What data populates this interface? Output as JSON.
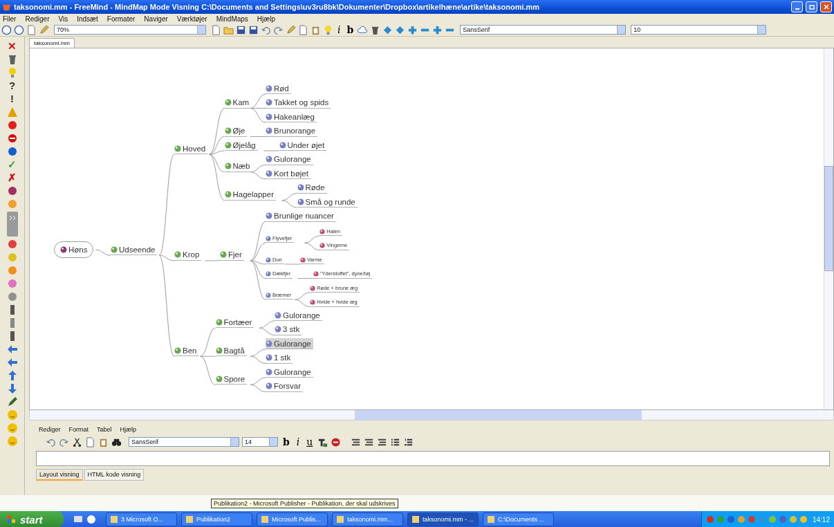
{
  "window": {
    "title": "taksonomi.mm - FreeMind - MindMap Mode Visning C:\\Documents and Settings\\uv3ru8bk\\Dokumenter\\Dropbox\\artikelhæne\\artike\\taksonomi.mm"
  },
  "menu": [
    "Filer",
    "Rediger",
    "Vis",
    "Indsæt",
    "Formater",
    "Naviger",
    "Værktøjer",
    "MindMaps",
    "Hjælp"
  ],
  "toolbar": {
    "zoom": "70%",
    "italic": "i",
    "bold": "b",
    "font": "SansSerif",
    "size": "10"
  },
  "icon_palette": [
    {
      "kind": "glyph",
      "text": "✕",
      "color": "#d01010"
    },
    {
      "kind": "trash",
      "color": "#606060"
    },
    {
      "kind": "bulb",
      "color": "#f0d000"
    },
    {
      "kind": "glyph",
      "text": "?",
      "color": "#303030"
    },
    {
      "kind": "glyph",
      "text": "!",
      "color": "#303030"
    },
    {
      "kind": "warning",
      "color": "#e0a000"
    },
    {
      "kind": "dot",
      "color": "#e02020"
    },
    {
      "kind": "stop",
      "color": "#d01010"
    },
    {
      "kind": "dot",
      "color": "#1060d0"
    },
    {
      "kind": "glyph",
      "text": "✓",
      "color": "#30a030"
    },
    {
      "kind": "glyph",
      "text": "✗",
      "color": "#d01010"
    },
    {
      "kind": "dot",
      "color": "#a03060"
    },
    {
      "kind": "dot",
      "color": "#f0a030"
    },
    {
      "kind": "expander",
      "color": "#9a9a9a"
    },
    {
      "kind": "dot",
      "color": "#e04040"
    },
    {
      "kind": "dot",
      "color": "#e0c020"
    },
    {
      "kind": "dot",
      "color": "#f09020"
    },
    {
      "kind": "dot",
      "color": "#e070c0"
    },
    {
      "kind": "dot",
      "color": "#909090"
    },
    {
      "kind": "bar",
      "color": "#555555"
    },
    {
      "kind": "bar",
      "color": "#888888"
    },
    {
      "kind": "bar",
      "color": "#555555"
    },
    {
      "kind": "arrow-left",
      "color": "#3070d0"
    },
    {
      "kind": "arrow-left",
      "color": "#3070d0"
    },
    {
      "kind": "arrow-up",
      "color": "#3070d0"
    },
    {
      "kind": "arrow-down",
      "color": "#3070d0"
    },
    {
      "kind": "pencil",
      "color": "#3a6a2a"
    },
    {
      "kind": "smiley",
      "color": "#f0c000"
    },
    {
      "kind": "smiley",
      "color": "#f0c000"
    },
    {
      "kind": "smiley",
      "color": "#f0c000"
    }
  ],
  "tabs": [
    {
      "label": "taksonomi.mm",
      "selected": true
    }
  ],
  "map": {
    "root": {
      "label": "Høns",
      "color": "#8a3a7a",
      "selected": false,
      "children": [
        {
          "label": "Udseende",
          "color": "#6aa84f",
          "selected": false,
          "children": [
            {
              "label": "Hoved",
              "color": "#6aa84f",
              "selected": false,
              "children": [
                {
                  "label": "Kam",
                  "color": "#6aa84f",
                  "selected": false,
                  "children": [
                    {
                      "label": "Rød",
                      "color": "#7b7fc4",
                      "selected": false
                    },
                    {
                      "label": "Takket og spids",
                      "color": "#7b7fc4",
                      "selected": false
                    },
                    {
                      "label": "Hakeanlæg",
                      "color": "#7b7fc4",
                      "selected": false
                    }
                  ]
                },
                {
                  "label": "Øje",
                  "color": "#6aa84f",
                  "selected": false,
                  "children": [
                    {
                      "label": "Brunorange",
                      "color": "#7b7fc4",
                      "selected": false
                    }
                  ]
                },
                {
                  "label": "Øjelåg",
                  "color": "#6aa84f",
                  "selected": false,
                  "children": [
                    {
                      "label": "Under øjet",
                      "color": "#7b7fc4",
                      "selected": false
                    }
                  ]
                },
                {
                  "label": "Næb",
                  "color": "#6aa84f",
                  "selected": false,
                  "children": [
                    {
                      "label": "Gulorange",
                      "color": "#7b7fc4",
                      "selected": false
                    },
                    {
                      "label": "Kort bøjet",
                      "color": "#7b7fc4",
                      "selected": false
                    }
                  ]
                },
                {
                  "label": "Hagelapper",
                  "color": "#6aa84f",
                  "selected": false,
                  "children": [
                    {
                      "label": "Røde",
                      "color": "#7b7fc4",
                      "selected": false
                    },
                    {
                      "label": "Små og runde",
                      "color": "#7b7fc4",
                      "selected": false
                    }
                  ]
                }
              ]
            },
            {
              "label": "Krop",
              "color": "#6aa84f",
              "selected": false,
              "children": [
                {
                  "label": "Fjer",
                  "color": "#6aa84f",
                  "selected": false,
                  "children": [
                    {
                      "label": "Brunlige nuancer",
                      "color": "#7b7fc4",
                      "selected": false,
                      "kind": "normal"
                    },
                    {
                      "label": "Flyvefjer",
                      "color": "#7b7fc4",
                      "selected": false,
                      "kind": "small",
                      "children": [
                        {
                          "label": "Halen",
                          "color": "#c0506a",
                          "selected": false,
                          "kind": "small"
                        },
                        {
                          "label": "Vingerne",
                          "color": "#c0506a",
                          "selected": false,
                          "kind": "small"
                        }
                      ]
                    },
                    {
                      "label": "Dun",
                      "color": "#7b7fc4",
                      "selected": false,
                      "kind": "small",
                      "children": [
                        {
                          "label": "Varme",
                          "color": "#c0506a",
                          "selected": false,
                          "kind": "small"
                        }
                      ]
                    },
                    {
                      "label": "Dækfjer",
                      "color": "#7b7fc4",
                      "selected": false,
                      "kind": "small",
                      "children": [
                        {
                          "label": "\"Yderstoffet\", dyne/tøj",
                          "color": "#c0506a",
                          "selected": false,
                          "kind": "small"
                        }
                      ]
                    },
                    {
                      "label": "Bræmer",
                      "color": "#7b7fc4",
                      "selected": false,
                      "kind": "small",
                      "children": [
                        {
                          "label": "Røde + brune æg",
                          "color": "#c0506a",
                          "selected": false,
                          "kind": "small"
                        },
                        {
                          "label": "Hvide + hvide æg",
                          "color": "#c0506a",
                          "selected": false,
                          "kind": "small"
                        }
                      ]
                    }
                  ]
                }
              ]
            },
            {
              "label": "Ben",
              "color": "#6aa84f",
              "selected": false,
              "children": [
                {
                  "label": "Fortæer",
                  "color": "#6aa84f",
                  "selected": false,
                  "children": [
                    {
                      "label": "Gulorange",
                      "color": "#7b7fc4",
                      "selected": false
                    },
                    {
                      "label": "3 stk",
                      "color": "#7b7fc4",
                      "selected": false
                    }
                  ]
                },
                {
                  "label": "Bagtå",
                  "color": "#6aa84f",
                  "selected": false,
                  "children": [
                    {
                      "label": "Gulorange",
                      "color": "#7b7fc4",
                      "selected": true
                    },
                    {
                      "label": "1 stk",
                      "color": "#7b7fc4",
                      "selected": false
                    }
                  ]
                },
                {
                  "label": "Spore",
                  "color": "#6aa84f",
                  "selected": false,
                  "children": [
                    {
                      "label": "Gulorange",
                      "color": "#7b7fc4",
                      "selected": false
                    },
                    {
                      "label": "Forsvar",
                      "color": "#7b7fc4",
                      "selected": false
                    }
                  ]
                }
              ]
            }
          ]
        }
      ]
    }
  },
  "editor": {
    "menu": [
      "Rediger",
      "Format",
      "Tabel",
      "Hjælp"
    ],
    "font": "SansSerif",
    "size": "14",
    "bold": "b",
    "italic": "i",
    "underline": "u",
    "tabs": [
      {
        "label": "Layout visning",
        "selected": true
      },
      {
        "label": "HTML kode visning",
        "selected": false
      }
    ]
  },
  "tooltip": "Publikation2 - Microsoft Publisher - Publikation, der skal udskrives",
  "taskbar": {
    "start": "start",
    "buttons": [
      {
        "label": "3 Microsoft O...",
        "selected": false
      },
      {
        "label": "Publikation2",
        "selected": false
      },
      {
        "label": "Microsoft Publis...",
        "selected": false
      },
      {
        "label": "taksonomi.mm...",
        "selected": false
      },
      {
        "label": "taksonomi.mm - ...",
        "selected": true
      },
      {
        "label": "C:\\Documents ...",
        "selected": false
      }
    ],
    "clock": "14:12"
  }
}
